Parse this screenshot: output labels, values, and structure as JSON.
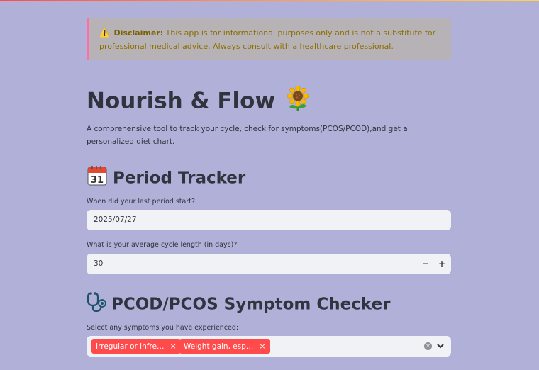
{
  "disclaimer": {
    "icon": "warning-icon",
    "label": "Disclaimer:",
    "text": "This app is for informational purposes only and is not a substitute for professional medical advice. Always consult with a healthcare professional."
  },
  "header": {
    "title": "Nourish & Flow",
    "title_icon": "sunflower-icon",
    "subtitle": "A comprehensive tool to track your cycle, check for symptoms(PCOS/PCOD),and get a personalized diet chart."
  },
  "period_tracker": {
    "heading": "Period Tracker",
    "heading_icon": "calendar-icon",
    "last_period_label": "When did your last period start?",
    "last_period_value": "2025/07/27",
    "cycle_length_label": "What is your average cycle length (in days)?",
    "cycle_length_value": "30",
    "minus_label": "−",
    "plus_label": "+"
  },
  "symptom_checker": {
    "heading": "PCOD/PCOS Symptom Checker",
    "heading_icon": "stethoscope-icon",
    "select_label": "Select any symptoms you have experienced:",
    "selected": [
      "Irregular or infre…",
      "Weight gain, esp…"
    ],
    "tag_remove": "×"
  },
  "colors": {
    "background": "#b0b0d8",
    "accent": "#ff4b4b",
    "input_bg": "#f0f2f6",
    "disclaimer_border": "#ff6fa3"
  }
}
